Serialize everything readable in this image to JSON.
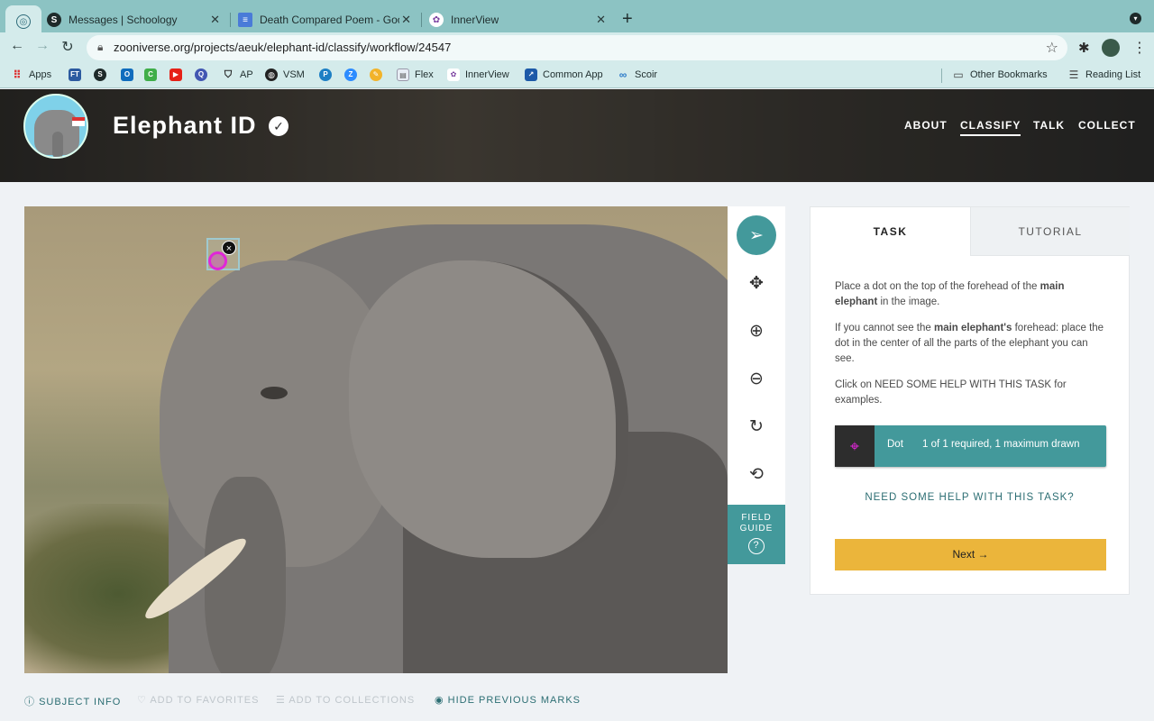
{
  "browser": {
    "tabs": [
      {
        "title": "Messages | Schoology",
        "icon": "S"
      },
      {
        "title": "Death Compared Poem - Goog",
        "icon": "≡"
      },
      {
        "title": "InnerView",
        "icon": "✿"
      }
    ],
    "url": "zooniverse.org/projects/aeuk/elephant-id/classify/workflow/24547",
    "bookmarks": [
      "Apps",
      "FT",
      "S",
      "O",
      "C",
      "▶",
      "Q",
      "AP",
      "VSM",
      "P",
      "Z",
      "✎",
      "Flex",
      "InnerView",
      "Common App",
      "Scoir"
    ],
    "bookmarks_right": [
      "Other Bookmarks",
      "Reading List"
    ],
    "accent": "#8cc3c3"
  },
  "project": {
    "title": "Elephant ID",
    "nav": [
      "ABOUT",
      "CLASSIFY",
      "TALK",
      "COLLECT"
    ],
    "active_nav": "CLASSIFY"
  },
  "viewer": {
    "tools": [
      "pointer-icon",
      "move-icon",
      "zoom-in-icon",
      "zoom-out-icon",
      "rotate-icon",
      "reset-icon"
    ],
    "field_guide": [
      "FIELD",
      "GUIDE"
    ],
    "field_guide_icon": "?",
    "mark_delete": "×"
  },
  "panel": {
    "tabs": [
      "TASK",
      "TUTORIAL"
    ],
    "instruction_1_a": "Place a dot on the top of the forehead of the ",
    "instruction_1_b": "main elephant",
    "instruction_1_c": " in the image.",
    "instruction_2_a": "If you cannot see the ",
    "instruction_2_b": "main elephant's",
    "instruction_2_c": " forehead: place the dot in the center of all the parts of the elephant you can see.",
    "instruction_3": "Click on NEED SOME HELP WITH THIS TASK for examples.",
    "tool_name": "Dot",
    "tool_status": "1 of 1 required, 1 maximum drawn",
    "help": "NEED SOME HELP WITH THIS TASK?",
    "next": "Next →",
    "accent": "#43999b",
    "next_color": "#ebb53b"
  },
  "footer": {
    "subject_info": "SUBJECT INFO",
    "favorites": "ADD TO FAVORITES",
    "collections": "ADD TO COLLECTIONS",
    "hide_marks": "HIDE PREVIOUS MARKS"
  }
}
